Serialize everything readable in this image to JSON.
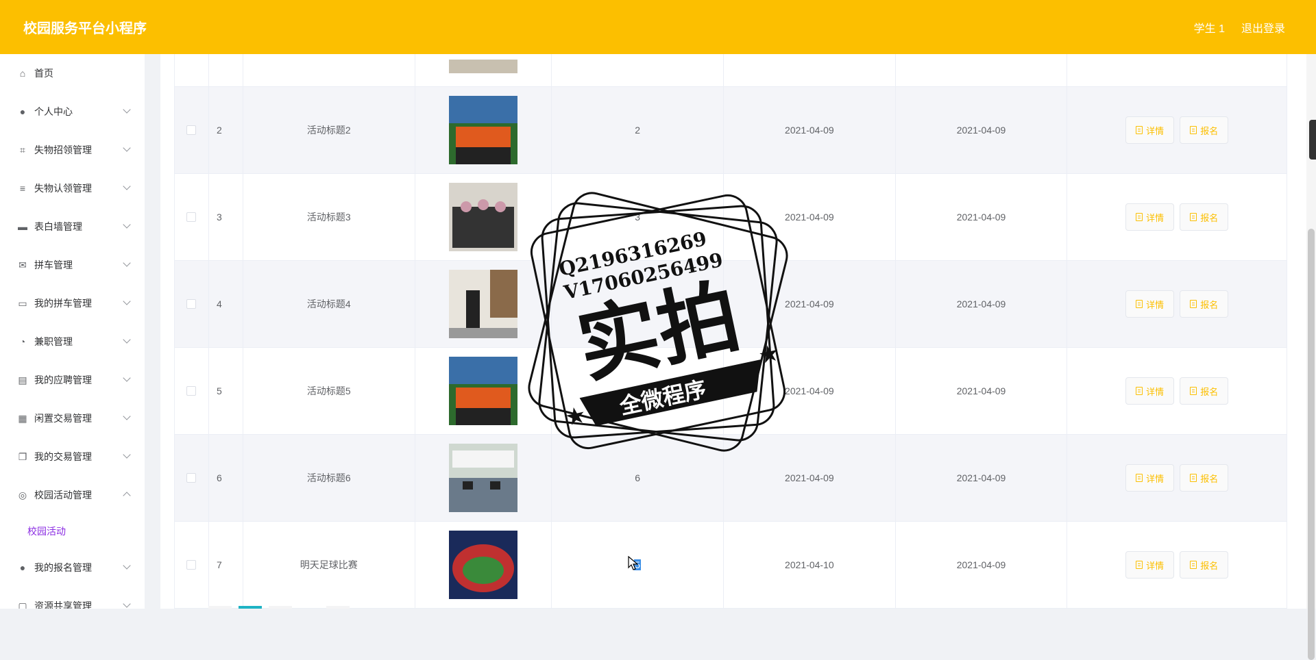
{
  "header": {
    "title": "校园服务平台小程序",
    "user": "学生 1",
    "logout": "退出登录"
  },
  "sidebar": {
    "items": [
      {
        "label": "首页",
        "icon": "home-icon",
        "glyph": "⌂",
        "expandable": false
      },
      {
        "label": "个人中心",
        "icon": "user-icon",
        "glyph": "●",
        "expandable": true
      },
      {
        "label": "失物招领管理",
        "icon": "crop-icon",
        "glyph": "⌗",
        "expandable": true
      },
      {
        "label": "失物认领管理",
        "icon": "menu-icon",
        "glyph": "≡",
        "expandable": true
      },
      {
        "label": "表白墙管理",
        "icon": "printer-icon",
        "glyph": "▬",
        "expandable": true
      },
      {
        "label": "拼车管理",
        "icon": "mail-icon",
        "glyph": "✉",
        "expandable": true
      },
      {
        "label": "我的拼车管理",
        "icon": "chat-icon",
        "glyph": "▭",
        "expandable": true
      },
      {
        "label": "兼职管理",
        "icon": "bell-off-icon",
        "glyph": "◔",
        "expandable": true
      },
      {
        "label": "我的应聘管理",
        "icon": "clipboard-icon",
        "glyph": "▤",
        "expandable": true
      },
      {
        "label": "闲置交易管理",
        "icon": "grid-icon",
        "glyph": "▦",
        "expandable": true
      },
      {
        "label": "我的交易管理",
        "icon": "copy-icon",
        "glyph": "❐",
        "expandable": true
      },
      {
        "label": "校园活动管理",
        "icon": "compass-icon",
        "glyph": "◎",
        "expandable": true,
        "expanded": true
      }
    ],
    "submenu_active": "校园活动",
    "items_after": [
      {
        "label": "我的报名管理",
        "icon": "user-icon",
        "glyph": "●",
        "expandable": true
      },
      {
        "label": "资源共享管理",
        "icon": "lock-icon",
        "glyph": "▢",
        "expandable": true
      }
    ]
  },
  "table": {
    "rows": [
      {
        "index": "",
        "title": "",
        "num": "",
        "date1": "",
        "date2": "",
        "img": "partial",
        "alt": false,
        "ops": false
      },
      {
        "index": "2",
        "title": "活动标题2",
        "num": "2",
        "date1": "2021-04-09",
        "date2": "2021-04-09",
        "img": "team",
        "alt": true,
        "ops": true
      },
      {
        "index": "3",
        "title": "活动标题3",
        "num": "3",
        "date1": "2021-04-09",
        "date2": "2021-04-09",
        "img": "group",
        "alt": false,
        "ops": true
      },
      {
        "index": "4",
        "title": "活动标题4",
        "num": "",
        "date1": "2021-04-09",
        "date2": "2021-04-09",
        "img": "room",
        "alt": true,
        "ops": true
      },
      {
        "index": "5",
        "title": "活动标题5",
        "num": "",
        "date1": "2021-04-09",
        "date2": "2021-04-09",
        "img": "team",
        "alt": false,
        "ops": true
      },
      {
        "index": "6",
        "title": "活动标题6",
        "num": "6",
        "date1": "2021-04-09",
        "date2": "2021-04-09",
        "img": "class",
        "alt": true,
        "ops": true
      },
      {
        "index": "7",
        "title": "明天足球比赛",
        "num": "5",
        "date1": "2021-04-10",
        "date2": "2021-04-09",
        "img": "stadium",
        "alt": false,
        "ops": true,
        "num_selected": true
      }
    ],
    "btn_detail": "详情",
    "btn_signup": "报名"
  },
  "watermark": {
    "line1": "Q2196316269",
    "line2": "V17060256499",
    "big": "实拍",
    "ribbon": "全微程序"
  },
  "colors": {
    "header": "#fcbf00",
    "accent": "#fcbf00",
    "submenu": "#8a2be2"
  }
}
